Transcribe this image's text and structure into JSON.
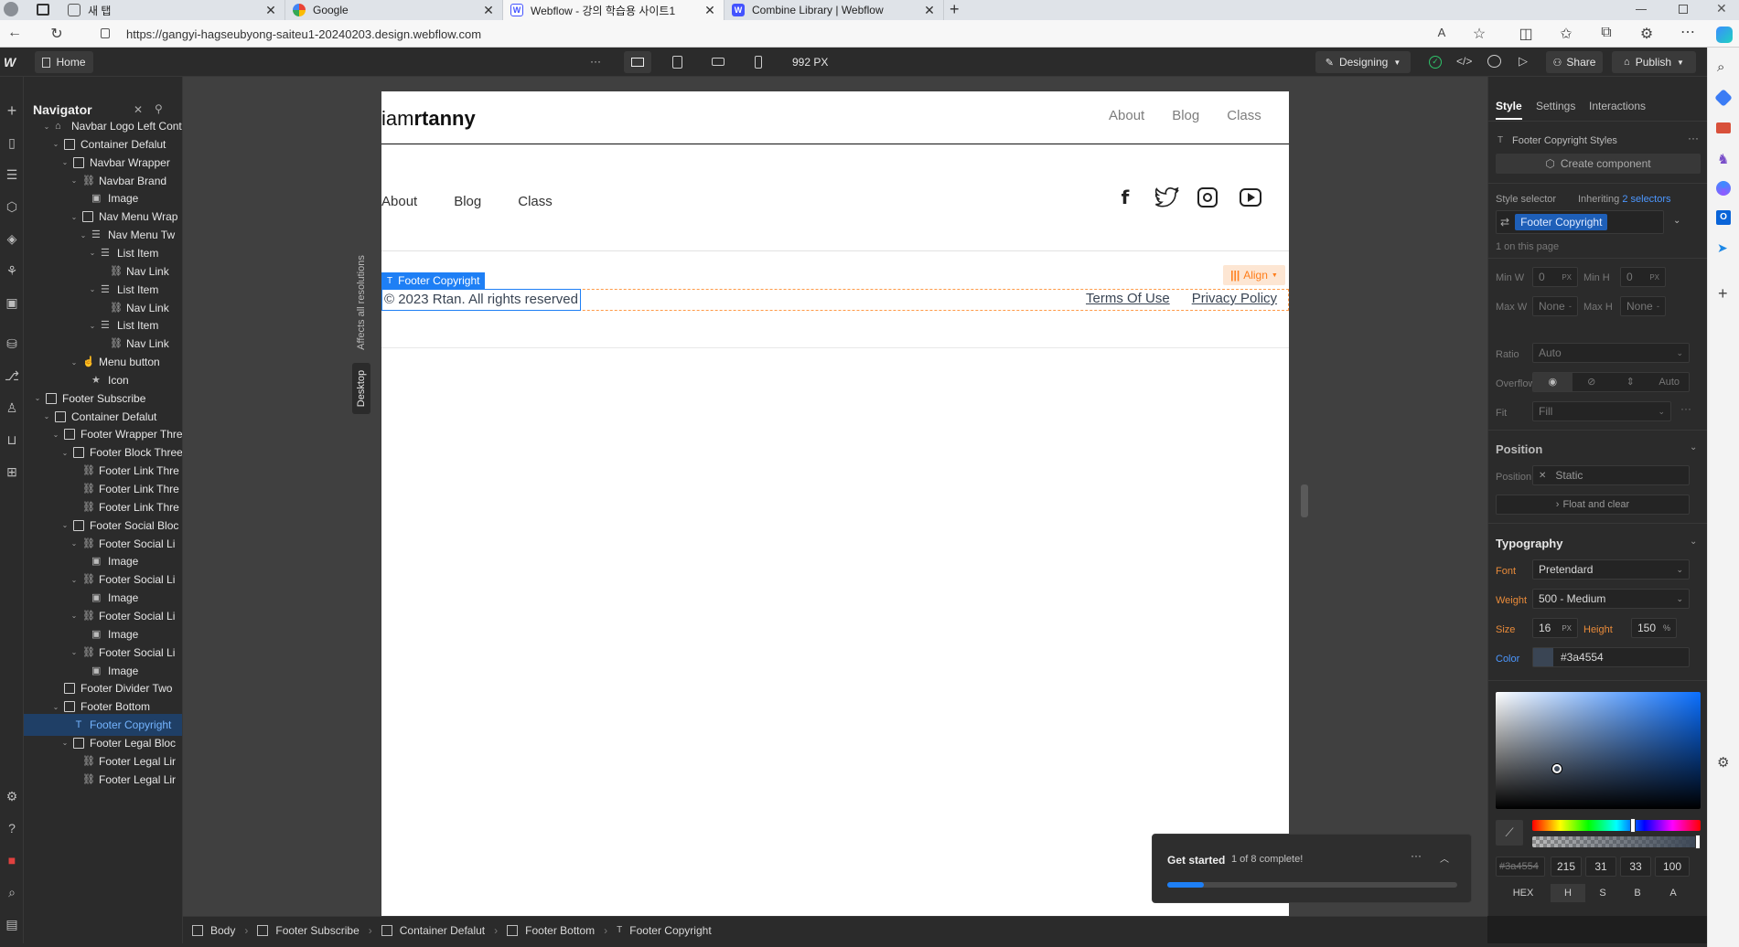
{
  "browser": {
    "tabs": [
      {
        "title": "새 탭",
        "active": false
      },
      {
        "title": "Google",
        "active": false
      },
      {
        "title": "Webflow - 강의 학습용 사이트1",
        "active": true
      },
      {
        "title": "Combine Library | Webflow",
        "active": false
      }
    ],
    "url": "https://gangyi-hagseubyong-saiteu1-20240203.design.webflow.com"
  },
  "topbar": {
    "page_label": "Home",
    "more": "···",
    "width_label": "992 PX",
    "mode_label": "Designing",
    "share_label": "Share",
    "publish_label": "Publish"
  },
  "navigator": {
    "title": "Navigator",
    "items": [
      {
        "label": "Navbar Logo Left Cont",
        "depth": 0,
        "icon": "component",
        "caret": true
      },
      {
        "label": "Container Defalut",
        "depth": 1,
        "icon": "box",
        "caret": true
      },
      {
        "label": "Navbar Wrapper",
        "depth": 2,
        "icon": "box",
        "caret": true
      },
      {
        "label": "Navbar Brand",
        "depth": 3,
        "icon": "link",
        "caret": true
      },
      {
        "label": "Image",
        "depth": 4,
        "icon": "image",
        "caret": false
      },
      {
        "label": "Nav Menu Wrap",
        "depth": 3,
        "icon": "box",
        "caret": true
      },
      {
        "label": "Nav Menu Tw",
        "depth": 4,
        "icon": "list",
        "caret": true
      },
      {
        "label": "List Item",
        "depth": 5,
        "icon": "list",
        "caret": true
      },
      {
        "label": "Nav Link",
        "depth": 6,
        "icon": "link",
        "caret": false
      },
      {
        "label": "List Item",
        "depth": 5,
        "icon": "list",
        "caret": true
      },
      {
        "label": "Nav Link",
        "depth": 6,
        "icon": "link",
        "caret": false
      },
      {
        "label": "List Item",
        "depth": 5,
        "icon": "list",
        "caret": true
      },
      {
        "label": "Nav Link",
        "depth": 6,
        "icon": "link",
        "caret": false
      },
      {
        "label": "Menu button",
        "depth": 3,
        "icon": "hand",
        "caret": true
      },
      {
        "label": "Icon",
        "depth": 4,
        "icon": "star",
        "caret": false
      },
      {
        "label": "Footer Subscribe",
        "depth": -1,
        "icon": "box",
        "caret": true
      },
      {
        "label": "Container Defalut",
        "depth": 0,
        "icon": "box",
        "caret": true
      },
      {
        "label": "Footer Wrapper Thre",
        "depth": 1,
        "icon": "box",
        "caret": true
      },
      {
        "label": "Footer Block Three",
        "depth": 2,
        "icon": "box",
        "caret": true
      },
      {
        "label": "Footer Link Thre",
        "depth": 3,
        "icon": "link",
        "caret": false
      },
      {
        "label": "Footer Link Thre",
        "depth": 3,
        "icon": "link",
        "caret": false
      },
      {
        "label": "Footer Link Thre",
        "depth": 3,
        "icon": "link",
        "caret": false
      },
      {
        "label": "Footer Social Bloc",
        "depth": 2,
        "icon": "box",
        "caret": true
      },
      {
        "label": "Footer Social Li",
        "depth": 3,
        "icon": "link",
        "caret": true
      },
      {
        "label": "Image",
        "depth": 4,
        "icon": "image",
        "caret": false
      },
      {
        "label": "Footer Social Li",
        "depth": 3,
        "icon": "link",
        "caret": true
      },
      {
        "label": "Image",
        "depth": 4,
        "icon": "image",
        "caret": false
      },
      {
        "label": "Footer Social Li",
        "depth": 3,
        "icon": "link",
        "caret": true
      },
      {
        "label": "Image",
        "depth": 4,
        "icon": "image",
        "caret": false
      },
      {
        "label": "Footer Social Li",
        "depth": 3,
        "icon": "link",
        "caret": true
      },
      {
        "label": "Image",
        "depth": 4,
        "icon": "image",
        "caret": false
      },
      {
        "label": "Footer Divider Two",
        "depth": 1,
        "icon": "box",
        "caret": false
      },
      {
        "label": "Footer Bottom",
        "depth": 1,
        "icon": "box",
        "caret": true
      },
      {
        "label": "Footer Copyright",
        "depth": 2,
        "icon": "text",
        "caret": false,
        "selected": true
      },
      {
        "label": "Footer Legal Bloc",
        "depth": 2,
        "icon": "box",
        "caret": true
      },
      {
        "label": "Footer Legal Lir",
        "depth": 3,
        "icon": "link",
        "caret": false
      },
      {
        "label": "Footer Legal Lir",
        "depth": 3,
        "icon": "link",
        "caret": false
      }
    ]
  },
  "canvas": {
    "vertical_labels": {
      "affects": "Affects all resolutions",
      "desktop": "Desktop"
    },
    "brand": {
      "light": "iam",
      "bold": "rtanny"
    },
    "nav_links": [
      "About",
      "Blog",
      "Class"
    ],
    "footer_links": [
      "About",
      "Blog",
      "Class"
    ],
    "selected_tag": "Footer Copyright",
    "align_label": "Align",
    "copyright": "© 2023 Rtan. All rights reserved",
    "legal": [
      "Terms Of Use",
      "Privacy Policy"
    ]
  },
  "right_panel": {
    "tabs": [
      "Style",
      "Settings",
      "Interactions"
    ],
    "element_styles": "Footer Copyright Styles",
    "create_component": "Create component",
    "style_selector_label": "Style selector",
    "inheriting_prefix": "Inheriting",
    "inheriting_link": "2 selectors",
    "selector_chip": "Footer Copyright",
    "on_page": "1 on this page",
    "size": {
      "min_w_label": "Min W",
      "min_w": "0",
      "min_w_unit": "PX",
      "min_h_label": "Min H",
      "min_h": "0",
      "min_h_unit": "PX",
      "max_w_label": "Max W",
      "max_w": "None",
      "max_w_unit": "-",
      "max_h_label": "Max H",
      "max_h": "None",
      "max_h_unit": "-"
    },
    "ratio_label": "Ratio",
    "ratio": "Auto",
    "overflow_label": "Overflow",
    "overflow_auto": "Auto",
    "fit_label": "Fit",
    "fit": "Fill",
    "position_head": "Position",
    "position_label": "Position",
    "position": "Static",
    "float_clear": "Float and clear",
    "typography_head": "Typography",
    "font_label": "Font",
    "font": "Pretendard",
    "weight_label": "Weight",
    "weight": "500 - Medium",
    "size_label": "Size",
    "size_val": "16",
    "size_unit": "PX",
    "height_label": "Height",
    "height_val": "150",
    "height_unit": "%",
    "color_label": "Color",
    "color_hex": "#3a4554",
    "picker": {
      "hex_value": "#3a4554",
      "h": "215",
      "s": "31",
      "b": "33",
      "a": "100",
      "modes": [
        "HEX",
        "H",
        "S",
        "B",
        "A"
      ]
    }
  },
  "get_started": {
    "title": "Get started",
    "progress_text": "1 of 8 complete!",
    "progress": 0.125
  },
  "breadcrumbs": [
    "Body",
    "Footer Subscribe",
    "Container Defalut",
    "Footer Bottom",
    "Footer Copyright"
  ],
  "colors": {
    "accent": "#1e7ff5",
    "selected_text": "#74b4ff",
    "align_orange": "#ff7d1a",
    "label_orange": "#e98b3a",
    "label_blue": "#4c97ff",
    "copyright_color": "#3a4554"
  }
}
